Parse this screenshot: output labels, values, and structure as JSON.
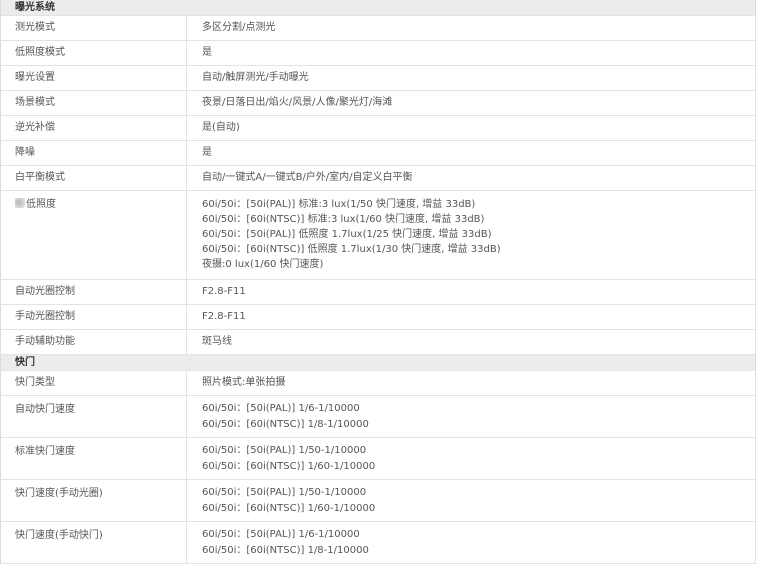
{
  "sections": [
    {
      "title": "曝光系统",
      "rows": [
        {
          "label": "测光模式",
          "lines": [
            "多区分割/点测光"
          ]
        },
        {
          "label": "低照度模式",
          "lines": [
            "是"
          ]
        },
        {
          "label": "曝光设置",
          "lines": [
            "自动/触屏测光/手动曝光"
          ]
        },
        {
          "label": "场景模式",
          "lines": [
            "夜景/日落日出/焰火/风景/人像/聚光灯/海滩"
          ]
        },
        {
          "label": "逆光补偿",
          "lines": [
            "是(自动)"
          ]
        },
        {
          "label": "降噪",
          "lines": [
            "是"
          ]
        },
        {
          "label": "白平衡模式",
          "lines": [
            "自动/一键式A/一键式B/户外/室内/自定义白平衡"
          ]
        },
        {
          "label": "低照度",
          "lines": [
            "60i/50i：[50i(PAL)] 标准:3 lux(1/50 快门速度, 增益 33dB)",
            "60i/50i：[60i(NTSC)] 标准:3 lux(1/60 快门速度, 增益 33dB)",
            "60i/50i：[50i(PAL)] 低照度 1.7lux(1/25 快门速度, 增益 33dB)",
            "60i/50i：[60i(NTSC)] 低照度 1.7lux(1/30 快门速度, 增益 33dB)",
            "夜摄:0 lux(1/60 快门速度)"
          ]
        },
        {
          "label": "自动光圈控制",
          "lines": [
            "F2.8-F11"
          ]
        },
        {
          "label": "手动光圈控制",
          "lines": [
            "F2.8-F11"
          ]
        },
        {
          "label": "手动辅助功能",
          "lines": [
            "斑马线"
          ]
        }
      ]
    },
    {
      "title": "快门",
      "rows": [
        {
          "label": "快门类型",
          "lines": [
            "照片模式:单张拍摄"
          ]
        },
        {
          "label": "自动快门速度",
          "lines": [
            "60i/50i：[50i(PAL)] 1/6-1/10000",
            "60i/50i：[60i(NTSC)] 1/8-1/10000"
          ]
        },
        {
          "label": "标准快门速度",
          "lines": [
            "60i/50i：[50i(PAL)] 1/50-1/10000",
            "60i/50i：[60i(NTSC)] 1/60-1/10000"
          ]
        },
        {
          "label": "快门速度(手动光圈)",
          "lines": [
            "60i/50i：[50i(PAL)] 1/50-1/10000",
            "60i/50i：[60i(NTSC)] 1/60-1/10000"
          ]
        },
        {
          "label": "快门速度(手动快门)",
          "lines": [
            "60i/50i：[50i(PAL)] 1/6-1/10000",
            "60i/50i：[60i(NTSC)] 1/8-1/10000"
          ]
        }
      ]
    }
  ]
}
